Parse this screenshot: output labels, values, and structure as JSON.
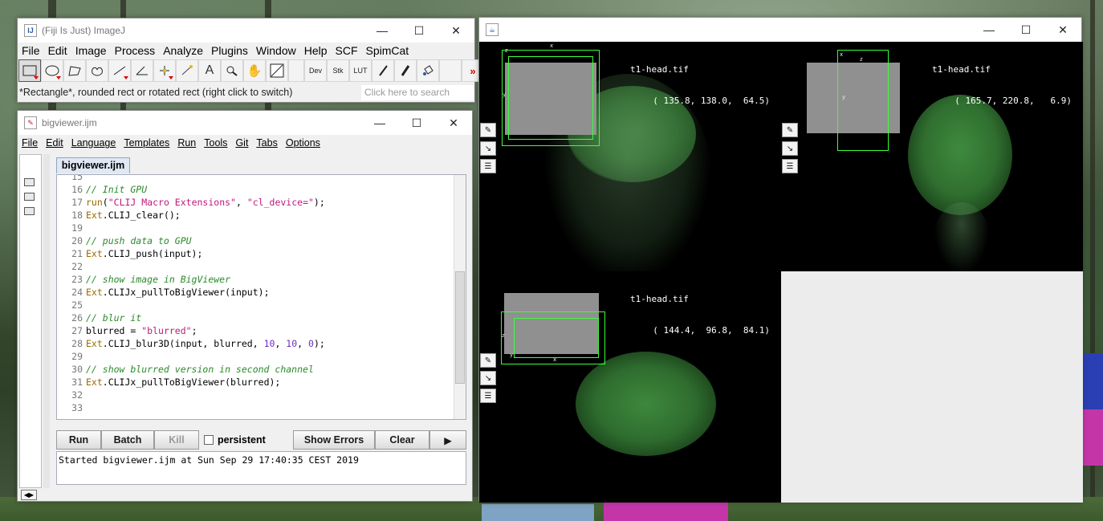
{
  "imagej": {
    "title": "(Fiji Is Just) ImageJ",
    "menu": [
      "File",
      "Edit",
      "Image",
      "Process",
      "Analyze",
      "Plugins",
      "Window",
      "Help",
      "SCF",
      "SpimCat"
    ],
    "tools": [
      "rectangle-tool-icon",
      "oval-tool-icon",
      "polygon-tool-icon",
      "freehand-tool-icon",
      "line-tool-icon",
      "angle-tool-icon",
      "point-tool-icon",
      "wand-tool-icon",
      "text-tool-icon",
      "magnifier-icon",
      "hand-icon",
      "color-picker-icon"
    ],
    "dev_label": "Dev",
    "stk_label": "Stk",
    "lut_label": "LUT",
    "more_label": "»",
    "status": "*Rectangle*, rounded rect or rotated rect (right click to switch)",
    "search_placeholder": "Click here to search"
  },
  "editor": {
    "title": "bigviewer.ijm",
    "menu": [
      "File",
      "Edit",
      "Language",
      "Templates",
      "Run",
      "Tools",
      "Git",
      "Tabs",
      "Options"
    ],
    "tab_label": "bigviewer.ijm",
    "lines": [
      {
        "n": "15",
        "text": ""
      },
      {
        "n": "16",
        "text": "// Init GPU"
      },
      {
        "n": "17",
        "text": "run(\"CLIJ Macro Extensions\", \"cl_device=\");"
      },
      {
        "n": "18",
        "text": "Ext.CLIJ_clear();"
      },
      {
        "n": "19",
        "text": ""
      },
      {
        "n": "20",
        "text": "// push data to GPU"
      },
      {
        "n": "21",
        "text": "Ext.CLIJ_push(input);"
      },
      {
        "n": "22",
        "text": ""
      },
      {
        "n": "23",
        "text": "// show image in BigViewer"
      },
      {
        "n": "24",
        "text": "Ext.CLIJx_pullToBigViewer(input);"
      },
      {
        "n": "25",
        "text": ""
      },
      {
        "n": "26",
        "text": "// blur it"
      },
      {
        "n": "27",
        "text": "blurred = \"blurred\";"
      },
      {
        "n": "28",
        "text": "Ext.CLIJ_blur3D(input, blurred, 10, 10, 0);"
      },
      {
        "n": "29",
        "text": ""
      },
      {
        "n": "30",
        "text": "// show blurred version in second channel"
      },
      {
        "n": "31",
        "text": "Ext.CLIJx_pullToBigViewer(blurred);"
      },
      {
        "n": "32",
        "text": ""
      },
      {
        "n": "33",
        "text": ""
      }
    ],
    "buttons": {
      "run": "Run",
      "batch": "Batch",
      "kill": "Kill",
      "persistent": "persistent",
      "show_errors": "Show Errors",
      "clear": "Clear",
      "play": "▶"
    },
    "console_text": "Started bigviewer.ijm at Sun Sep 29 17:40:35 CEST 2019"
  },
  "viewer": {
    "panes": [
      {
        "name": "t1-head.tif",
        "coords": "( 135.8, 138.0,  64.5)"
      },
      {
        "name": "t1-head.tif",
        "coords": "( 165.7, 220.8,   6.9)"
      },
      {
        "name": "t1-head.tif",
        "coords": "( 144.4,  96.8,  84.1)"
      }
    ],
    "axis_x": "x",
    "axis_y": "y",
    "axis_z": "z"
  },
  "colors": {
    "bbox": "#3bff3b",
    "comment": "#2a8a2a",
    "string": "#c2187a",
    "number": "#6b2fbf",
    "function": "#9a6b00"
  }
}
